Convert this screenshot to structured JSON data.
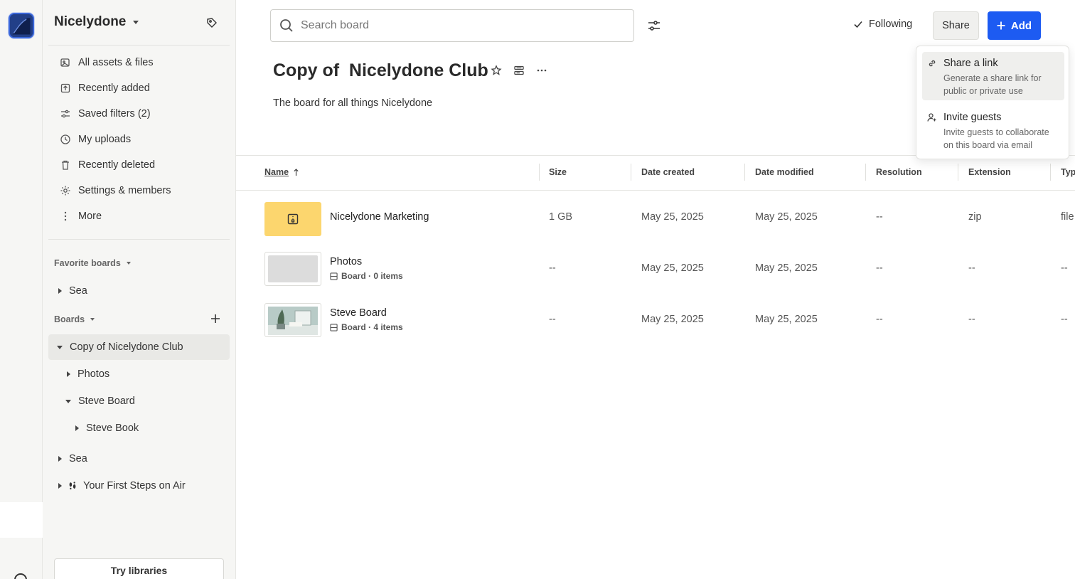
{
  "workspace": {
    "name": "Nicelydone"
  },
  "nav": [
    {
      "label": "All assets & files",
      "icon": "assets-icon"
    },
    {
      "label": "Recently added",
      "icon": "upload-box-icon"
    },
    {
      "label": "Saved filters (2)",
      "icon": "filters-icon"
    },
    {
      "label": "My uploads",
      "icon": "clock-icon"
    },
    {
      "label": "Recently deleted",
      "icon": "trash-icon"
    },
    {
      "label": "Settings & members",
      "icon": "gear-icon"
    },
    {
      "label": "More",
      "icon": "more-vertical-icon"
    }
  ],
  "favorites": {
    "heading": "Favorite boards",
    "items": [
      "Sea"
    ]
  },
  "boards": {
    "heading": "Boards",
    "tree": [
      {
        "label": "Copy of Nicelydone Club",
        "expanded": true,
        "active": true
      },
      {
        "label": "Photos",
        "expanded": false
      },
      {
        "label": "Steve Board",
        "expanded": true
      },
      {
        "label": "Steve Book",
        "expanded": false
      },
      {
        "label": "Sea",
        "expanded": false
      },
      {
        "label": "Your First Steps on Air",
        "expanded": false,
        "icon": "footsteps-icon"
      }
    ]
  },
  "try_libraries": "Try libraries",
  "search": {
    "placeholder": "Search board"
  },
  "header": {
    "following": "Following",
    "share": "Share",
    "add": "Add"
  },
  "board": {
    "title": "Copy of  Nicelydone Club",
    "description": "The board for all things Nicelydone"
  },
  "columns": [
    "Name",
    "Size",
    "Date created",
    "Date modified",
    "Resolution",
    "Extension",
    "Type"
  ],
  "rows": [
    {
      "name": "Nicelydone Marketing",
      "sub": "",
      "size": "1 GB",
      "created": "May 25, 2025",
      "modified": "May 25, 2025",
      "resolution": "--",
      "extension": "zip",
      "type": "file"
    },
    {
      "name": "Photos",
      "sub": "Board · 0 items",
      "size": "--",
      "created": "May 25, 2025",
      "modified": "May 25, 2025",
      "resolution": "--",
      "extension": "--",
      "type": "--"
    },
    {
      "name": "Steve Board",
      "sub": "Board · 4 items",
      "size": "--",
      "created": "May 25, 2025",
      "modified": "May 25, 2025",
      "resolution": "--",
      "extension": "--",
      "type": "--"
    }
  ],
  "share_menu": [
    {
      "title": "Share a link",
      "desc": "Generate a share link for public or private use",
      "icon": "link-icon"
    },
    {
      "title": "Invite guests",
      "desc": "Invite guests to collaborate on this board via email",
      "icon": "add-user-icon"
    }
  ],
  "colors": {
    "accent": "#1d5bf2",
    "zip_thumb": "#fcd66e",
    "sidebar_bg": "#f6f6f4"
  }
}
